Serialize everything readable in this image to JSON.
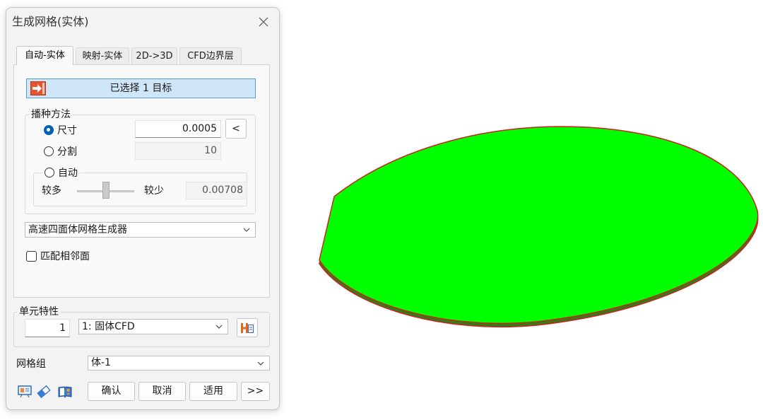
{
  "dialog": {
    "title": "生成网格(实体)",
    "close_icon": "close-icon",
    "tabs": [
      {
        "label": "自动-实体",
        "active": true
      },
      {
        "label": "映射-实体",
        "active": false
      },
      {
        "label": "2D->3D",
        "active": false
      },
      {
        "label": "CFD边界层",
        "active": false
      }
    ],
    "selection": {
      "icon": "select-arrow-icon",
      "label": "已选择 1 目标"
    },
    "seeding": {
      "legend": "播种方法",
      "size": {
        "label": "尺寸",
        "selected": true,
        "value": "0.0005",
        "button_label": "<"
      },
      "divisions": {
        "label": "分割",
        "selected": false,
        "value": "10"
      },
      "auto": {
        "label": "自动",
        "selected": false,
        "more_label": "较多",
        "less_label": "较少",
        "slider_level": 0.5,
        "value": "0.00708"
      }
    },
    "mesher": {
      "selected": "高速四面体网格生成器"
    },
    "match_faces": {
      "label": "匹配相邻面",
      "checked": false
    },
    "element_properties": {
      "legend": "单元特性",
      "id_value": "1",
      "selected": "1: 固体CFD",
      "editor_icon": "property-editor-icon"
    },
    "mesh_group": {
      "label": "网格组",
      "selected": "体-1"
    },
    "footer": {
      "tool_icons": [
        "display-icon",
        "eraser-icon",
        "help-book-icon"
      ],
      "ok_label": "确认",
      "cancel_label": "取消",
      "apply_label": "适用",
      "more_label": ">>"
    },
    "colors": {
      "accent": "#005fb8",
      "selection_bg": "#cfe5f8"
    }
  },
  "viewport": {
    "model": {
      "face_color": "#00ff00",
      "side_color": "#2f7d16",
      "edge_color": "#d11f1f"
    }
  }
}
